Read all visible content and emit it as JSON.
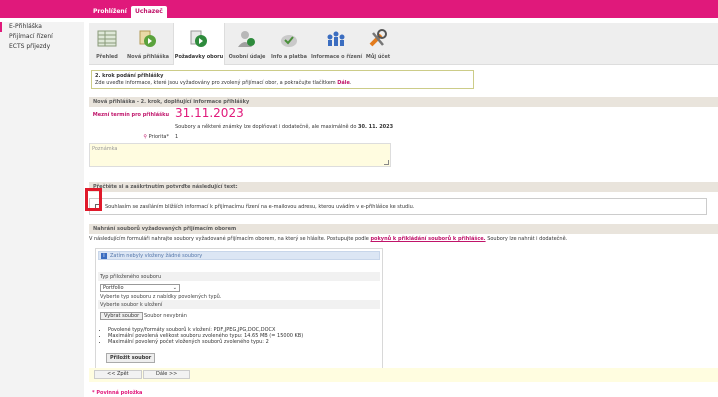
{
  "top_tabs": [
    "Prohlížení",
    "Uchazeč"
  ],
  "sidebar": {
    "items": [
      {
        "label": "E-Přihláška",
        "active": true
      },
      {
        "label": "Přijímací řízení",
        "active": false
      },
      {
        "label": "ECTS příjezdy",
        "active": false
      }
    ]
  },
  "toolbar": {
    "items": [
      {
        "label": "Přehled",
        "icon": "table-icon"
      },
      {
        "label": "Nová přihláška",
        "icon": "new-application-icon"
      },
      {
        "label": "Požadavky oboru",
        "icon": "requirements-icon",
        "active": true
      },
      {
        "label": "Osobní údaje",
        "icon": "person-icon"
      },
      {
        "label": "Info a platba",
        "icon": "payment-icon"
      },
      {
        "label": "Informace o řízení",
        "icon": "people-info-icon"
      },
      {
        "label": "Můj účet",
        "icon": "tools-icon"
      }
    ]
  },
  "step_box": {
    "title": "2. krok podání přihlášky",
    "text": "Zde uveďte informace, které jsou vyžadovány pro zvolený přijímací obor, a pokračujte tlačítkem",
    "accent": "Dále",
    "end": "."
  },
  "application": {
    "header": "Nová přihláška - 2. krok, doplňující informace přihlášky",
    "deadline_label": "Mezní termín pro přihlášku",
    "deadline": "31.11.2023",
    "files_note": "Soubory a některé známky lze doplňovat i dodatečně, ale maximálně do",
    "files_note_date": "30. 11. 2023",
    "priority_label": "Priorita*",
    "priority_value": "1",
    "note_placeholder": "Poznámka"
  },
  "consent": {
    "header": "Přečtěte si a zaškrtnutím potvrďte následující text:",
    "text": "Souhlasím se zasíláním bližších informací k přijímacímu řízení na e-mailovou adresu, kterou uvádím v e-přihlášce ke studiu."
  },
  "upload": {
    "header": "Nahrání souborů vyžadovaných přijímacím oborem",
    "intro": "V následujícím formuláři nahrajte soubory vyžadované přijímacím oborem, na který se hlásíte. Postupujte podle",
    "intro_link": "pokynů k přikládání souborů k přihlášce.",
    "intro_end": "Soubory lze nahrát i dodatečně.",
    "info": "Zatím nebyly vloženy žádné soubory",
    "type_label": "Typ přiloženého souboru",
    "type_value": "Portfolio",
    "type_hint": "Vyberte typ souboru z nabídky povolených typů.",
    "file_label": "Vyberte soubor k uložení",
    "file_button": "Vybrat soubor",
    "file_none": "Soubor nevybrán",
    "rules": [
      "Povolené typy/formáty souborů k vložení: PDF,JPEG,JPG,DOC,DOCX",
      "Maximální povolená velikost souboru zvoleného typu: 14.65 MB (= 15000 KB)",
      "Maximální povolený počet vložených souborů zvoleného typu: 2"
    ],
    "attach_button": "Přiložit soubor"
  },
  "nav": {
    "back": "<< Zpět",
    "next": "Dále >>"
  },
  "mandatory": "* Povinná položka",
  "colors": {
    "brand": "#e0197b",
    "highlight": "#e0192a"
  }
}
